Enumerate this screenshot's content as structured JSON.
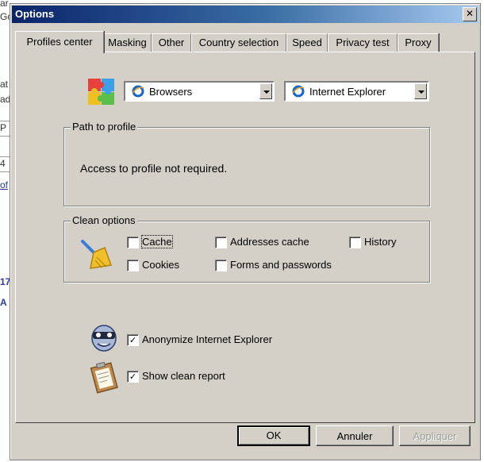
{
  "background": {
    "fragments": [
      "ar",
      "Go",
      "at",
      "ad",
      "P",
      "4",
      "of",
      "17",
      "A"
    ]
  },
  "dialog": {
    "title": "Options",
    "close_glyph": "✕"
  },
  "tabs": [
    {
      "label": "Profiles center",
      "active": true
    },
    {
      "label": "Masking"
    },
    {
      "label": "Other"
    },
    {
      "label": "Country selection"
    },
    {
      "label": "Speed"
    },
    {
      "label": "Privacy test"
    },
    {
      "label": "Proxy"
    }
  ],
  "profiles": {
    "category_value": "Browsers",
    "browser_value": "Internet Explorer"
  },
  "path_group": {
    "title": "Path to profile",
    "message": "Access to profile not required."
  },
  "clean_group": {
    "title": "Clean options",
    "options": [
      {
        "label": "Cache",
        "checked": false
      },
      {
        "label": "Addresses cache",
        "checked": false
      },
      {
        "label": "History",
        "checked": false
      },
      {
        "label": "Cookies",
        "checked": false
      },
      {
        "label": "Forms and passwords",
        "checked": false
      }
    ]
  },
  "anonymize": {
    "label": "Anonymize Internet Explorer",
    "checked": true
  },
  "clean_report": {
    "label": "Show clean report",
    "checked": true
  },
  "check_glyph": "✓",
  "buttons": {
    "ok": "OK",
    "cancel": "Annuler",
    "apply": "Appliquer"
  },
  "icons": [
    "puzzle-icon",
    "ie-icon",
    "broom-icon",
    "mask-icon",
    "report-icon"
  ]
}
